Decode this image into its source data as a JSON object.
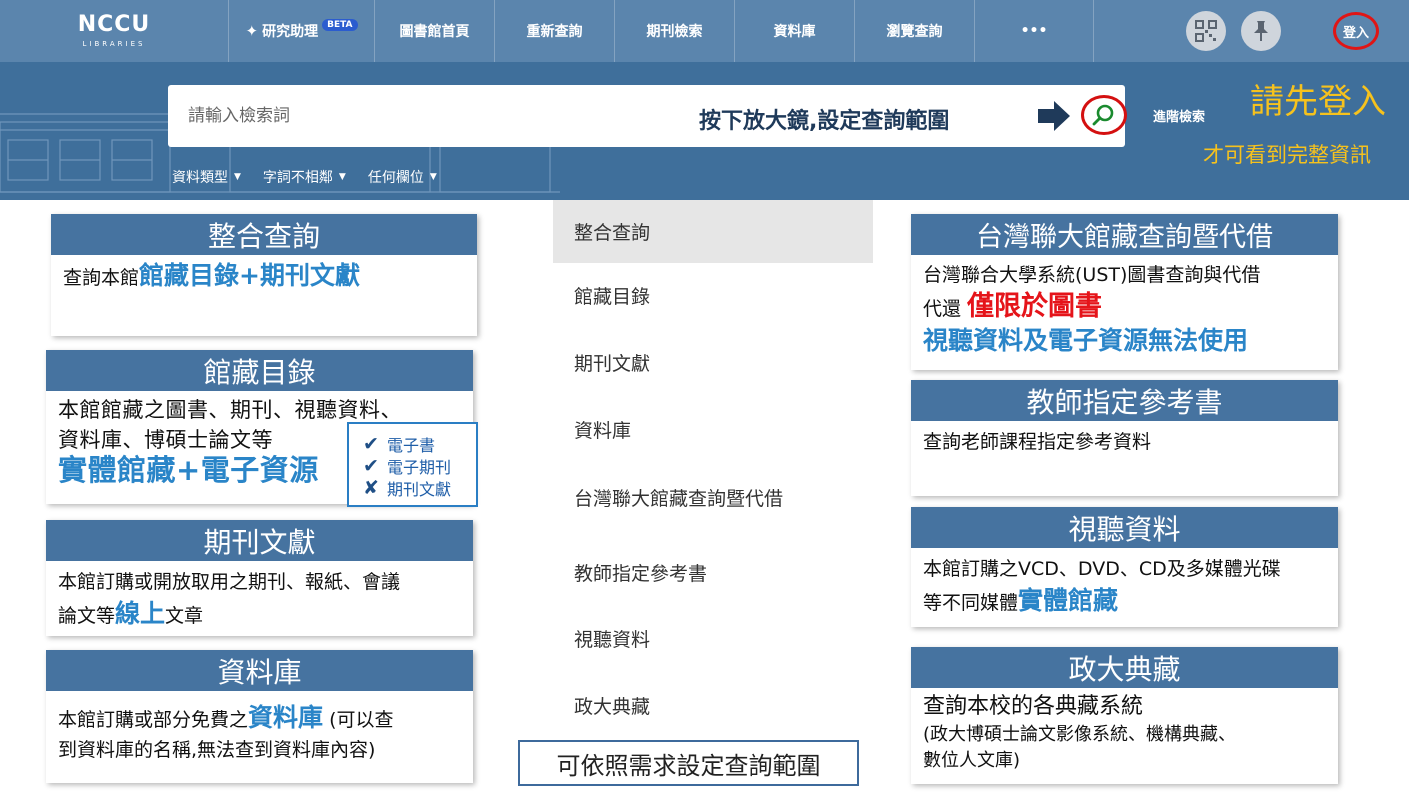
{
  "nav": {
    "logo_text": "NCCU",
    "logo_sub": "LIBRARIES",
    "ai_label": "研究助理",
    "beta_badge": "BETA",
    "items": [
      "圖書館首頁",
      "重新查詢",
      "期刊檢索",
      "資料庫",
      "瀏覽查詢"
    ],
    "more": "•••",
    "login": "登入"
  },
  "search": {
    "placeholder": "請輸入檢索詞",
    "hint": "按下放大鏡,設定查詢範圍",
    "advanced": "進階檢索",
    "login_note_line1": "請先登入",
    "login_note_line2": "才可看到完整資訊",
    "filters": [
      "資料類型",
      "字詞不相鄰",
      "任何欄位"
    ]
  },
  "left_cards": {
    "integrated": {
      "title": "整合查詢",
      "text_prefix": "查詢本館",
      "highlight": "館藏目錄+期刊文獻"
    },
    "catalog": {
      "title": "館藏目錄",
      "line1": "本館館藏之圖書、期刊、視聽資料、",
      "line2": "資料庫、博碩士論文等",
      "highlight": "實體館藏+電子資源",
      "checklist": [
        {
          "mark": "✔",
          "label": "電子書"
        },
        {
          "mark": "✔",
          "label": "電子期刊"
        },
        {
          "mark": "✘",
          "label": "期刊文獻"
        }
      ]
    },
    "journals": {
      "title": "期刊文獻",
      "line1": "本館訂購或開放取用之期刊、報紙、會議",
      "line2_prefix": "論文等",
      "highlight": "線上",
      "line2_suffix": "文章"
    },
    "database": {
      "title": "資料庫",
      "line1_prefix": "本館訂購或部分免費之",
      "highlight": "資料庫",
      "line1_suffix": " (可以查",
      "line2": "到資料庫的名稱,無法查到資料庫內容)"
    }
  },
  "menu": {
    "items": [
      "整合查詢",
      "館藏目錄",
      "期刊文獻",
      "資料庫",
      "台灣聯大館藏查詢暨代借",
      "教師指定參考書",
      "視聽資料",
      "政大典藏"
    ],
    "active_index": 0,
    "range_note": "可依照需求設定查詢範圍"
  },
  "right_cards": {
    "ust": {
      "title": "台灣聯大館藏查詢暨代借",
      "line1": "台灣聯合大學系統(UST)圖書查詢與代借",
      "line2_prefix": "代還",
      "highlight_red": "僅限於圖書",
      "line3": "視聽資料及電子資源無法使用"
    },
    "reserve": {
      "title": "教師指定參考書",
      "line1": "查詢老師課程指定參考資料"
    },
    "av": {
      "title": "視聽資料",
      "line1": "本館訂購之VCD、DVD、CD及多媒體光碟",
      "line2_prefix": "等不同媒體",
      "highlight": "實體館藏"
    },
    "archive": {
      "title": "政大典藏",
      "line1": "查詢本校的各典藏系統",
      "line2": "(政大博碩士論文影像系統、機構典藏、",
      "line3": "數位人文庫)"
    }
  },
  "colors": {
    "nav_bg": "#5b85ad",
    "hero_bg": "#3f6f9b",
    "card_header": "#4673a0",
    "highlight_blue": "#2a85c8",
    "highlight_red": "#e5141a",
    "login_note": "#f6c21d",
    "circle_red": "#d41010"
  }
}
